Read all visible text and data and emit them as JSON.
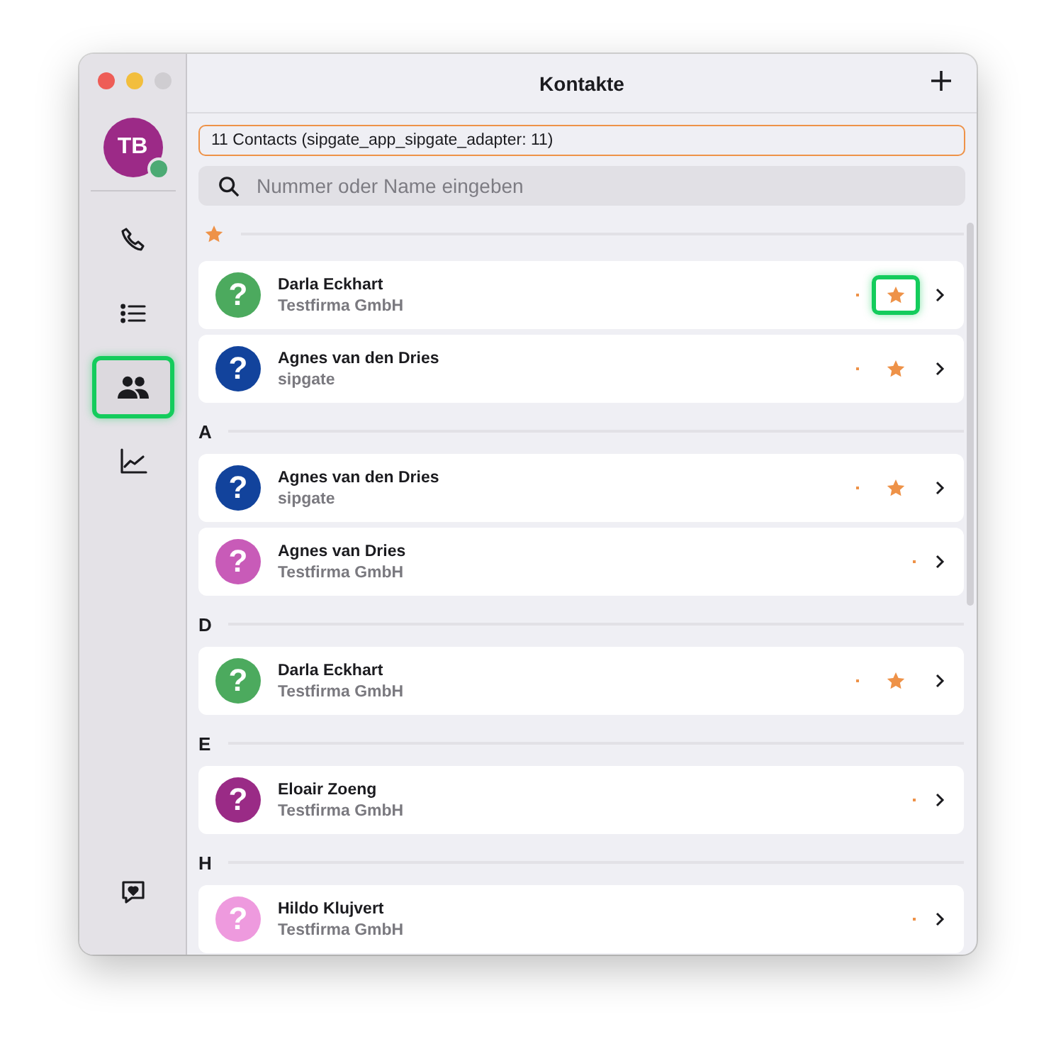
{
  "window": {
    "title": "Kontakte"
  },
  "user": {
    "initials": "TB",
    "online": true
  },
  "nav": [
    {
      "kind": "phone",
      "selected": false
    },
    {
      "kind": "list",
      "selected": false
    },
    {
      "kind": "contacts",
      "selected": true
    },
    {
      "kind": "chart",
      "selected": false
    }
  ],
  "feedback": {
    "kind": "chat-heart"
  },
  "info": "11 Contacts (sipgate_app_sipgate_adapter: 11)",
  "search": {
    "placeholder": "Nummer oder Name eingeben"
  },
  "sections": [
    {
      "kind": "favorites",
      "contacts": [
        {
          "name": "Darla Eckhart",
          "company": "Testfirma GmbH",
          "avatar_glyph": "?",
          "color": "#4caa5e",
          "favorite": true,
          "focused": true
        },
        {
          "name": "Agnes van den Dries",
          "company": "sipgate",
          "avatar_glyph": "?",
          "color": "#12439c",
          "favorite": true,
          "focused": false
        }
      ]
    },
    {
      "kind": "letter",
      "label": "A",
      "contacts": [
        {
          "name": "Agnes van den Dries",
          "company": "sipgate",
          "avatar_glyph": "?",
          "color": "#12439c",
          "favorite": true,
          "focused": false
        },
        {
          "name": "Agnes van Dries",
          "company": "Testfirma GmbH",
          "avatar_glyph": "?",
          "color": "#c85bb8",
          "favorite": false,
          "focused": false
        }
      ]
    },
    {
      "kind": "letter",
      "label": "D",
      "contacts": [
        {
          "name": "Darla Eckhart",
          "company": "Testfirma GmbH",
          "avatar_glyph": "?",
          "color": "#4caa5e",
          "favorite": true,
          "focused": false
        }
      ]
    },
    {
      "kind": "letter",
      "label": "E",
      "contacts": [
        {
          "name": "Eloair Zoeng",
          "company": "Testfirma GmbH",
          "avatar_glyph": "?",
          "color": "#9a2b86",
          "favorite": false,
          "focused": false
        }
      ]
    },
    {
      "kind": "letter",
      "label": "H",
      "contacts": [
        {
          "name": "Hildo Klujvert",
          "company": "Testfirma GmbH",
          "avatar_glyph": "?",
          "color": "#ee9ade",
          "favorite": false,
          "focused": false
        }
      ]
    }
  ]
}
